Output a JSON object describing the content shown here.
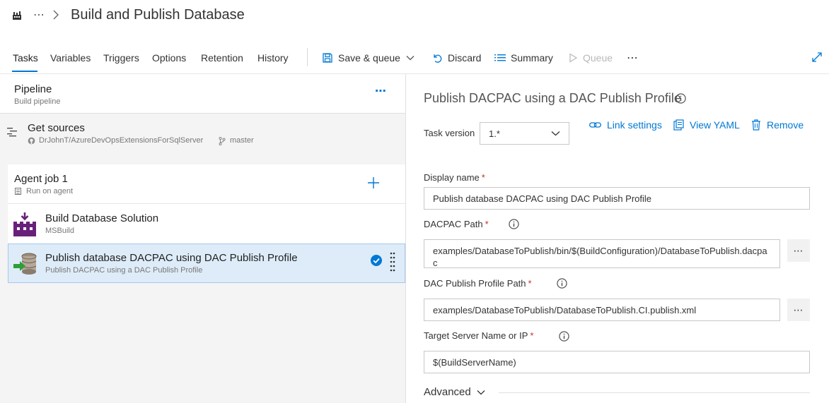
{
  "header": {
    "title": "Build and Publish Database",
    "more": "⋯"
  },
  "tabs": [
    {
      "label": "Tasks"
    },
    {
      "label": "Variables"
    },
    {
      "label": "Triggers"
    },
    {
      "label": "Options"
    },
    {
      "label": "Retention"
    },
    {
      "label": "History"
    }
  ],
  "toolbar": {
    "save_queue": "Save & queue",
    "discard": "Discard",
    "summary": "Summary",
    "queue": "Queue",
    "more": "⋯"
  },
  "pipeline": {
    "title": "Pipeline",
    "subtitle": "Build pipeline",
    "more": "⋯"
  },
  "sources": {
    "title": "Get sources",
    "repo": "DrJohnT/AzureDevOpsExtensionsForSqlServer",
    "branch": "master"
  },
  "agent_job": {
    "title": "Agent job 1",
    "subtitle": "Run on agent",
    "add": "+"
  },
  "tasks": [
    {
      "title": "Build Database Solution",
      "subtitle": "MSBuild"
    },
    {
      "title": "Publish database DACPAC using DAC Publish Profile",
      "subtitle": "Publish DACPAC using a DAC Publish Profile"
    }
  ],
  "detail": {
    "title": "Publish DACPAC using a DAC Publish Profile",
    "task_version_label": "Task version",
    "task_version_value": "1.*",
    "link_settings": "Link settings",
    "view_yaml": "View YAML",
    "remove": "Remove",
    "required_mark": "*",
    "display_name_label": "Display name",
    "display_name_value": "Publish database DACPAC using DAC Publish Profile",
    "dacpac_path_label": "DACPAC Path",
    "dacpac_path_value": "examples/DatabaseToPublish/bin/$(BuildConfiguration)/DatabaseToPublish.dacpac",
    "profile_path_label": "DAC Publish Profile Path",
    "profile_path_value": "examples/DatabaseToPublish/DatabaseToPublish.CI.publish.xml",
    "target_server_label": "Target Server Name or IP",
    "target_server_value": "$(BuildServerName)",
    "advanced_label": "Advanced",
    "ellipsis": "⋯"
  },
  "colors": {
    "accent": "#0078d4",
    "selected_bg": "#deecf9",
    "required": "#c5312b",
    "msbuild_purple": "#68217a"
  }
}
